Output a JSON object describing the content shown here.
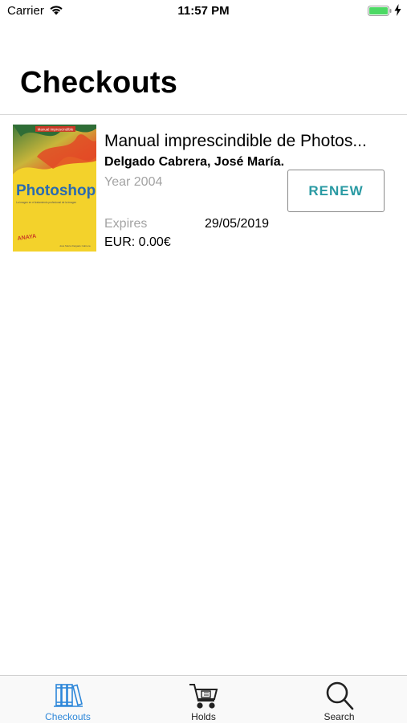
{
  "status_bar": {
    "carrier": "Carrier",
    "time": "11:57 PM",
    "battery_color": "#4cd964"
  },
  "header": {
    "title": "Checkouts"
  },
  "checkouts": [
    {
      "title": "Manual imprescindible de Photos...",
      "author": "Delgado Cabrera, José María.",
      "year": "Year 2004",
      "expires_label": "Expires",
      "expires_date": "29/05/2019",
      "fine": "EUR: 0.00€",
      "renew_label": "RENEW",
      "cover": {
        "top_band": "Manual imprescindible",
        "title": "Photoshop CS",
        "subtitle": "La imagen en el tratamiento profesional de la imagen",
        "publisher": "ANAYA",
        "author_line": "José María Delgado Cabrera"
      }
    }
  ],
  "tab_bar": {
    "accent_color": "#2e87d9",
    "tabs": [
      {
        "label": "Checkouts",
        "icon": "books-icon",
        "active": true
      },
      {
        "label": "Holds",
        "icon": "cart-icon",
        "active": false
      },
      {
        "label": "Search",
        "icon": "search-icon",
        "active": false
      }
    ]
  }
}
